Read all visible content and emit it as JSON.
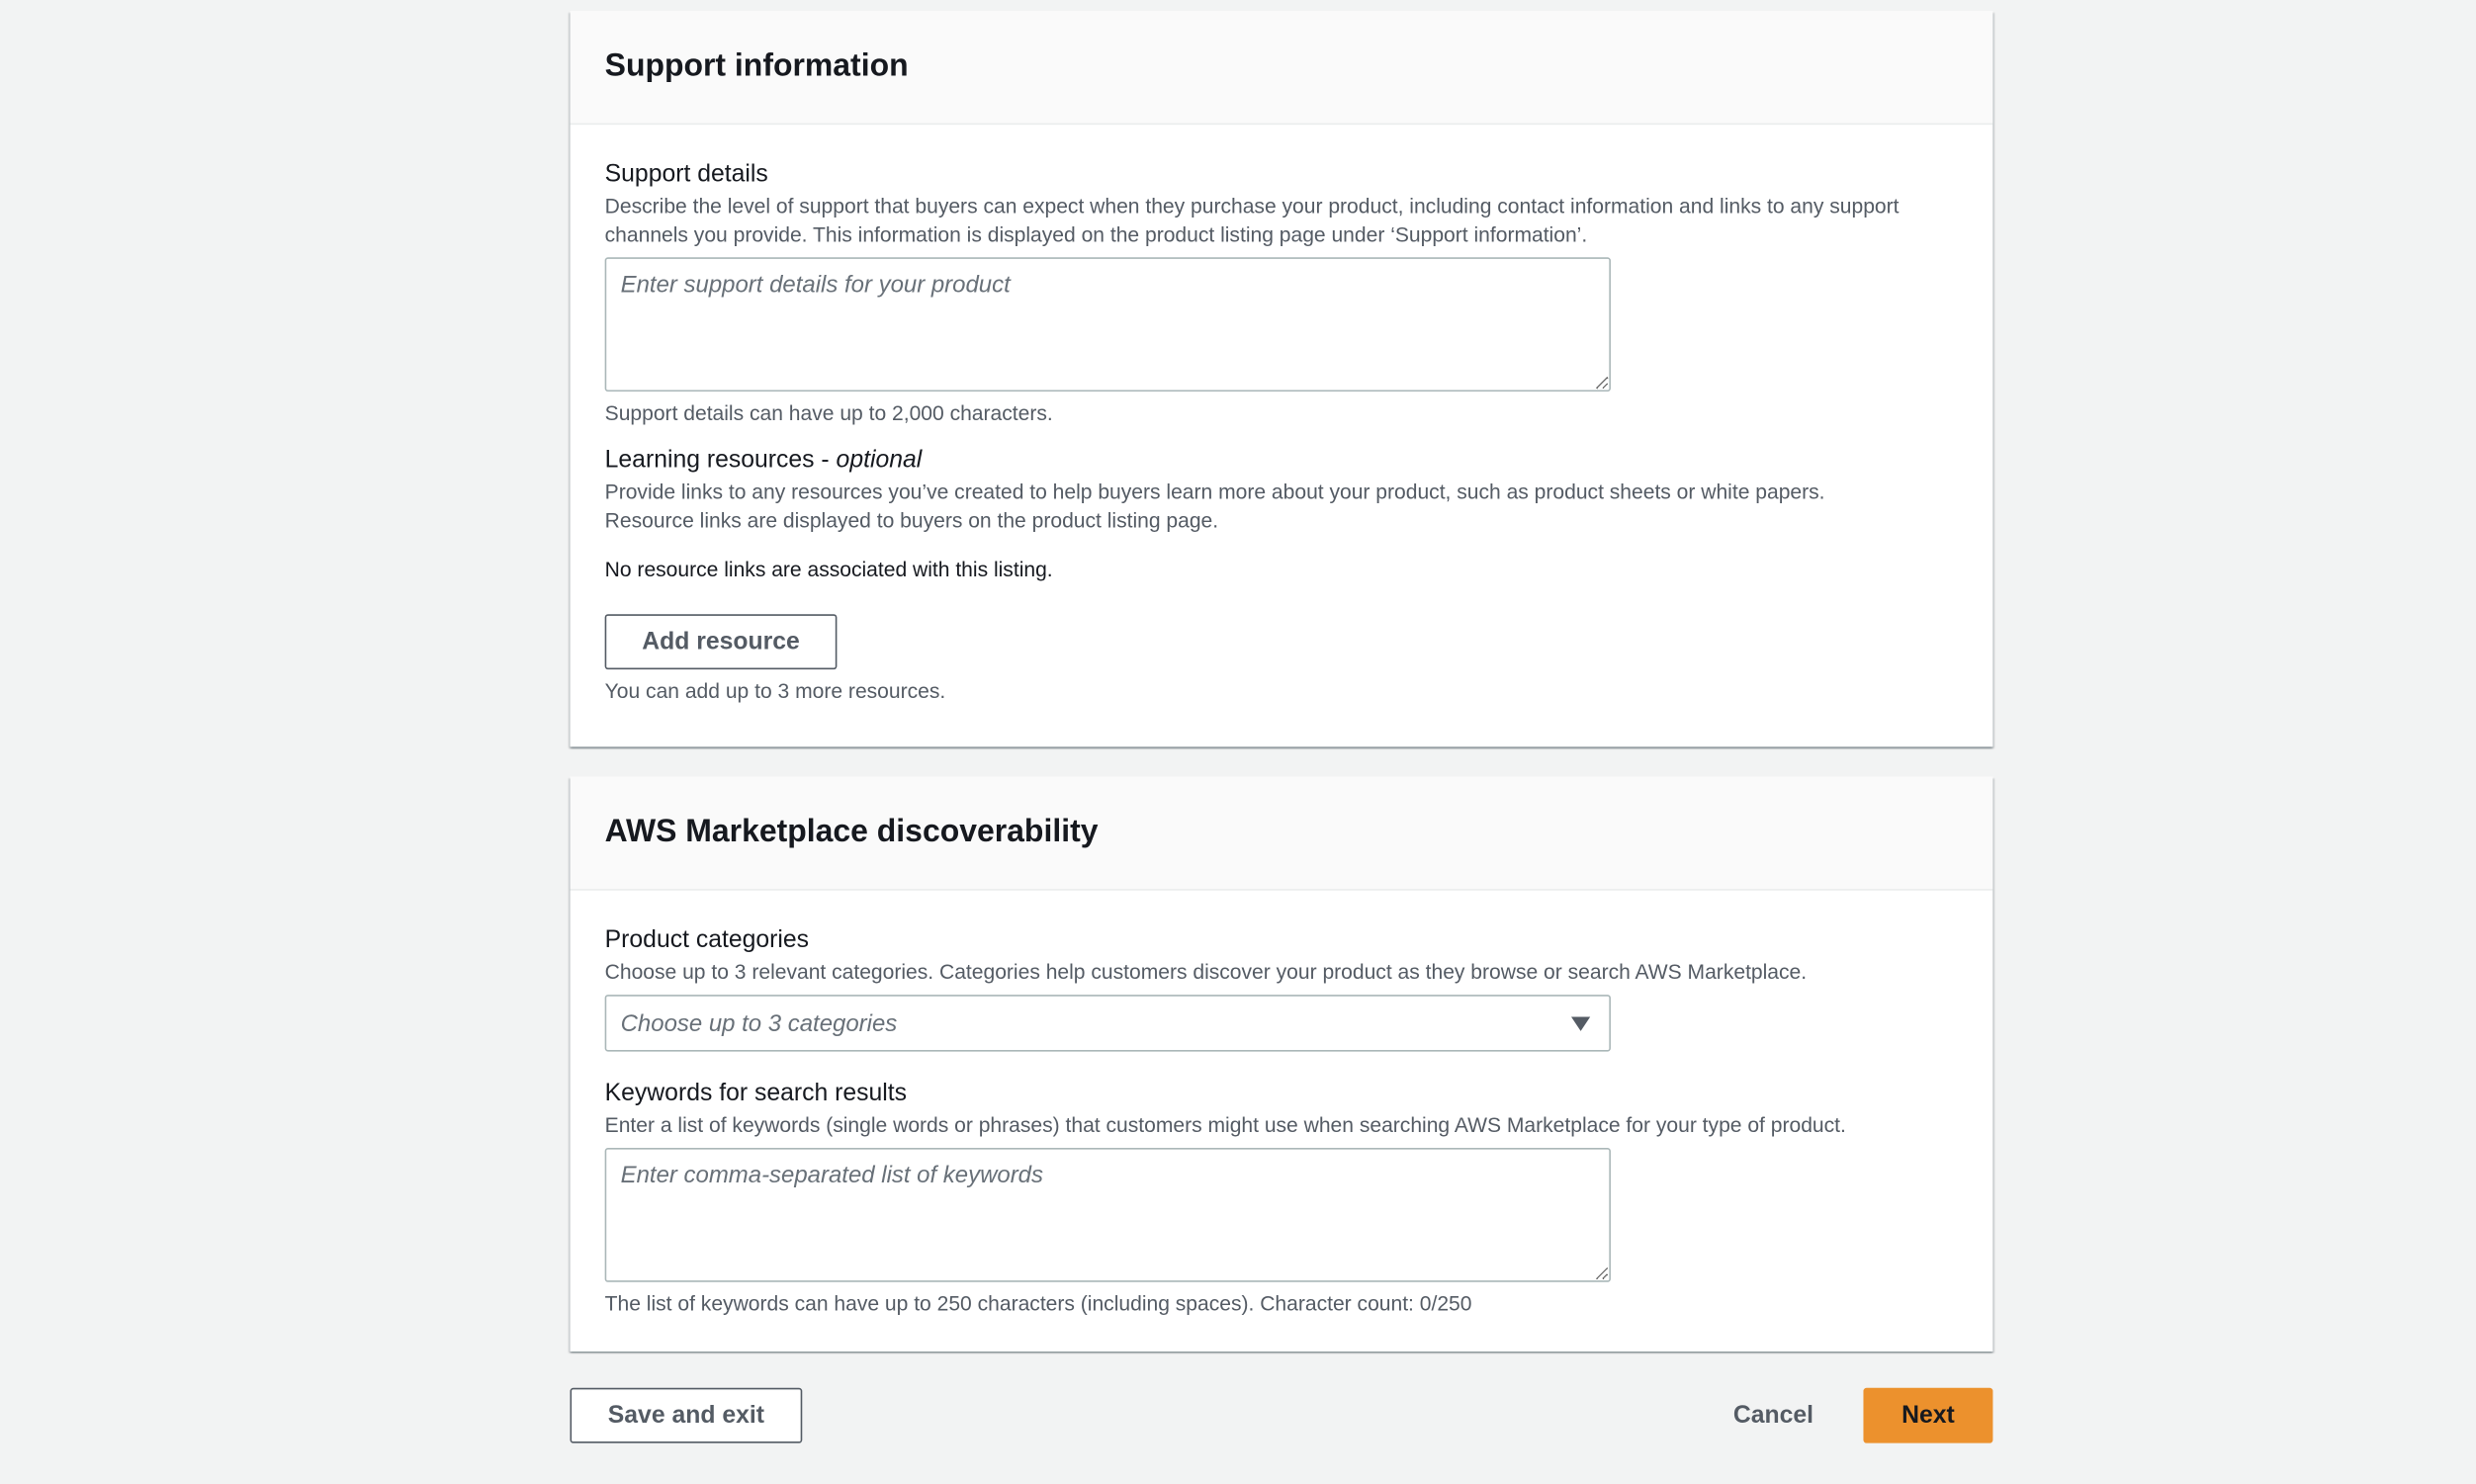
{
  "support": {
    "title": "Support information",
    "details_label": "Support details",
    "details_desc": "Describe the level of support that buyers can expect when they purchase your product, including contact information and links to any support channels you provide. This information is displayed on the product listing page under ‘Support information’.",
    "details_placeholder": "Enter support details for your product",
    "details_hint": "Support details can have up to 2,000 characters.",
    "learning_label": "Learning resources - ",
    "learning_optional": "optional",
    "learning_desc": "Provide links to any resources you’ve created to help buyers learn more about your product, such as product sheets or white papers. Resource links are displayed to buyers on the product listing page.",
    "no_links": "No resource links are associated with this listing.",
    "add_resource": "Add resource",
    "add_hint": "You can add up to 3 more resources."
  },
  "discoverability": {
    "title": "AWS Marketplace discoverability",
    "categories_label": "Product categories",
    "categories_desc": "Choose up to 3 relevant categories. Categories help customers discover your product as they browse or search AWS Marketplace.",
    "categories_placeholder": "Choose up to 3 categories",
    "keywords_label": "Keywords for search results",
    "keywords_desc": "Enter a list of keywords (single words or phrases) that customers might use when searching AWS Marketplace for your type of product.",
    "keywords_placeholder": "Enter comma-separated list of keywords",
    "keywords_hint": "The list of keywords can have up to 250 characters (including spaces). Character count: 0/250"
  },
  "footer": {
    "save_exit": "Save and exit",
    "cancel": "Cancel",
    "next": "Next"
  },
  "colors": {
    "primary": "#ec912d",
    "background": "#f2f3f3"
  }
}
